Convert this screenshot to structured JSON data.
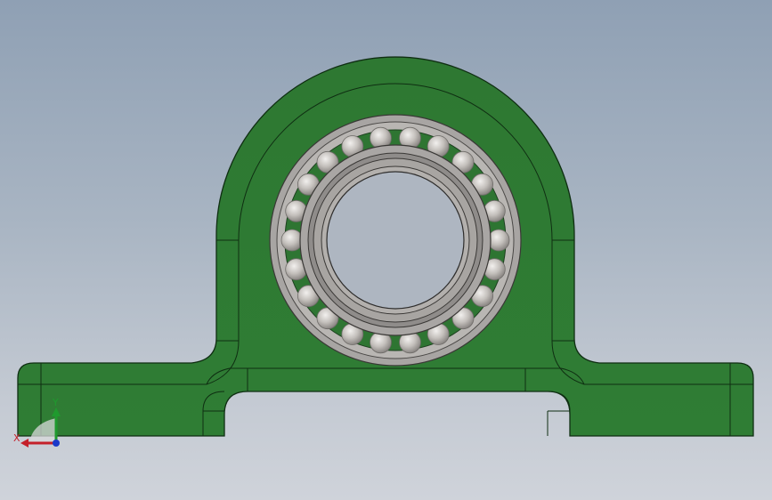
{
  "viewport": {
    "model": "pillow-block-bearing",
    "colors": {
      "background_top": "#8fa0b4",
      "background_bottom": "#cfd3da",
      "housing": "#2f7b34",
      "housing_edge": "#0f2e12",
      "bearing_ring": "#a8a5a3",
      "ball": "#bcb8b4"
    }
  },
  "triad": {
    "x_label": "X",
    "y_label": "Y",
    "x_color": "#c4202a",
    "y_color": "#1f9a2e",
    "z_color": "#1b39c9"
  }
}
